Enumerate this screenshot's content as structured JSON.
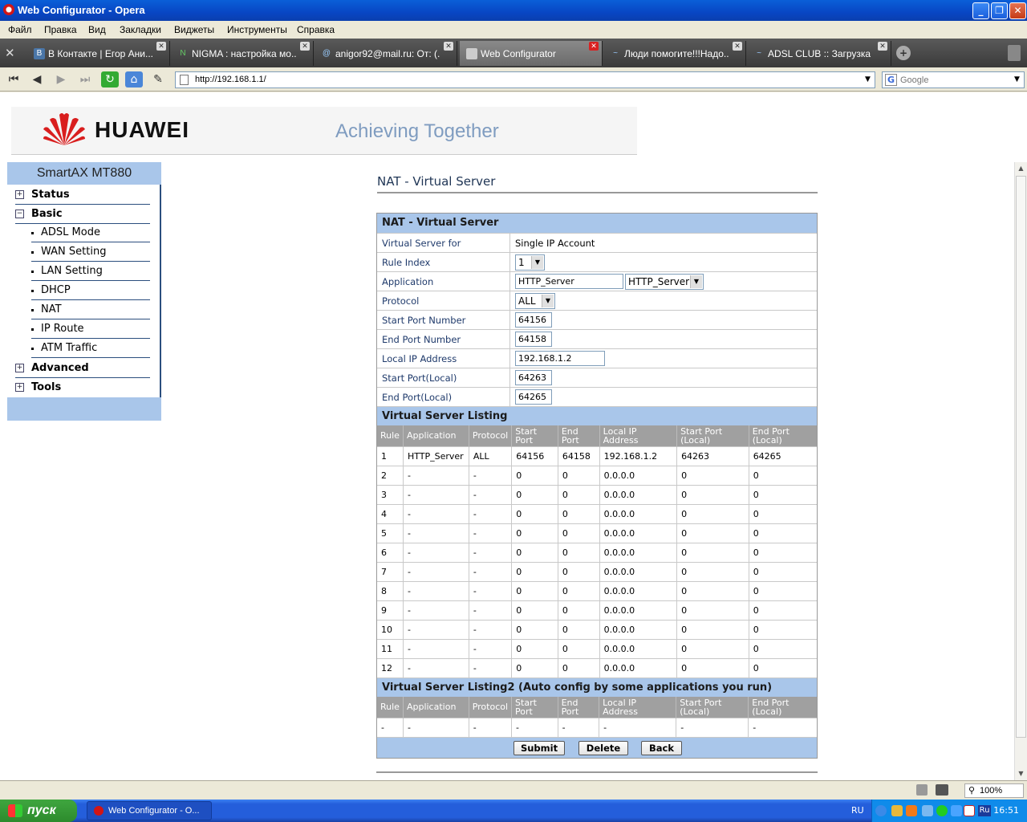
{
  "window": {
    "title": "Web Configurator - Opera"
  },
  "menu": [
    "Файл",
    "Правка",
    "Вид",
    "Закладки",
    "Виджеты",
    "Инструменты",
    "Справка"
  ],
  "tabs": [
    {
      "label": "В Контакте | Егор Ани...",
      "icon": "В"
    },
    {
      "label": "NIGMA : настройка мо...",
      "icon": "N"
    },
    {
      "label": "anigor92@mail.ru: От: (...",
      "icon": "@"
    },
    {
      "label": "Web Configurator",
      "icon": "",
      "active": true
    },
    {
      "label": "Люди помогите!!!Надо...",
      "icon": ""
    },
    {
      "label": "ADSL CLUB :: Загрузка ...",
      "icon": ""
    }
  ],
  "address": {
    "url": "http://192.168.1.1/",
    "search_placeholder": "Google"
  },
  "banner": {
    "brand": "HUAWEI",
    "tagline": "Achieving Together"
  },
  "sidebar": {
    "title": "SmartAX MT880",
    "sections": [
      {
        "label": "Status",
        "expanded": false
      },
      {
        "label": "Basic",
        "expanded": true
      },
      {
        "label": "Advanced",
        "expanded": false
      },
      {
        "label": "Tools",
        "expanded": false
      }
    ],
    "basic_items": [
      "ADSL Mode",
      "WAN Setting",
      "LAN Setting",
      "DHCP",
      "NAT",
      "IP Route",
      "ATM Traffic"
    ]
  },
  "page": {
    "title": "NAT - Virtual Server",
    "section_title": "NAT - Virtual Server",
    "fields": {
      "virtual_server_for": {
        "label": "Virtual Server for",
        "value": "Single IP Account"
      },
      "rule_index": {
        "label": "Rule Index",
        "value": "1"
      },
      "application": {
        "label": "Application",
        "value": "HTTP_Server",
        "select": "HTTP_Server"
      },
      "protocol": {
        "label": "Protocol",
        "value": "ALL"
      },
      "start_port": {
        "label": "Start Port Number",
        "value": "64156"
      },
      "end_port": {
        "label": "End Port Number",
        "value": "64158"
      },
      "local_ip": {
        "label": "Local IP Address",
        "value": "192.168.1.2"
      },
      "start_port_local": {
        "label": "Start Port(Local)",
        "value": "64263"
      },
      "end_port_local": {
        "label": "End Port(Local)",
        "value": "64265"
      }
    },
    "listing_title": "Virtual Server Listing",
    "listing2_title": "Virtual Server Listing2 (Auto config by some applications you run)",
    "columns": [
      "Rule",
      "Application",
      "Protocol",
      "Start Port",
      "End Port",
      "Local IP Address",
      "Start Port (Local)",
      "End Port (Local)"
    ],
    "rows": [
      [
        "1",
        "HTTP_Server",
        "ALL",
        "64156",
        "64158",
        "192.168.1.2",
        "64263",
        "64265"
      ],
      [
        "2",
        "-",
        "-",
        "0",
        "0",
        "0.0.0.0",
        "0",
        "0"
      ],
      [
        "3",
        "-",
        "-",
        "0",
        "0",
        "0.0.0.0",
        "0",
        "0"
      ],
      [
        "4",
        "-",
        "-",
        "0",
        "0",
        "0.0.0.0",
        "0",
        "0"
      ],
      [
        "5",
        "-",
        "-",
        "0",
        "0",
        "0.0.0.0",
        "0",
        "0"
      ],
      [
        "6",
        "-",
        "-",
        "0",
        "0",
        "0.0.0.0",
        "0",
        "0"
      ],
      [
        "7",
        "-",
        "-",
        "0",
        "0",
        "0.0.0.0",
        "0",
        "0"
      ],
      [
        "8",
        "-",
        "-",
        "0",
        "0",
        "0.0.0.0",
        "0",
        "0"
      ],
      [
        "9",
        "-",
        "-",
        "0",
        "0",
        "0.0.0.0",
        "0",
        "0"
      ],
      [
        "10",
        "-",
        "-",
        "0",
        "0",
        "0.0.0.0",
        "0",
        "0"
      ],
      [
        "11",
        "-",
        "-",
        "0",
        "0",
        "0.0.0.0",
        "0",
        "0"
      ],
      [
        "12",
        "-",
        "-",
        "0",
        "0",
        "0.0.0.0",
        "0",
        "0"
      ]
    ],
    "rows2": [
      [
        "-",
        "-",
        "-",
        "-",
        "-",
        "-",
        "-",
        "-"
      ]
    ],
    "buttons": {
      "submit": "Submit",
      "delete": "Delete",
      "back": "Back"
    }
  },
  "status": {
    "zoom": "100%"
  },
  "taskbar": {
    "start": "пуск",
    "item": "Web Configurator - O...",
    "lang": "RU",
    "clock": "16:51",
    "tray_lang": "Ru"
  },
  "colors": {
    "accent": "#a9c6ea",
    "header_gray": "#a0a0a0",
    "xp_blue": "#245edb"
  }
}
